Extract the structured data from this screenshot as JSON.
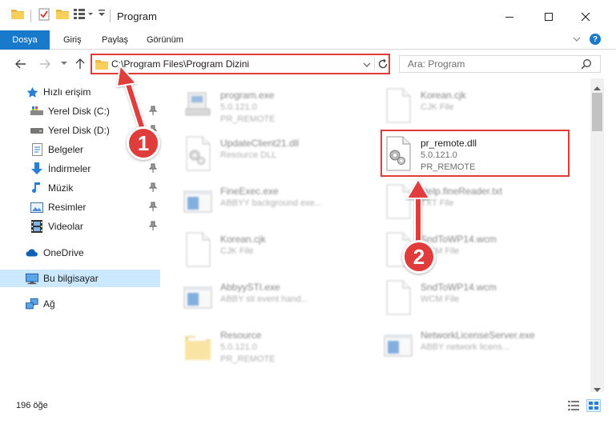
{
  "window": {
    "title": "Program"
  },
  "ribbon": {
    "tabs": [
      "Dosya",
      "Giriş",
      "Paylaş",
      "Görünüm"
    ]
  },
  "address": {
    "path": "C:\\Program Files\\Program Dizini"
  },
  "search": {
    "placeholder": "Ara: Program"
  },
  "sidebar": {
    "quick_access": "Hızlı erişim",
    "items": [
      "Yerel Disk (C:)",
      "Yerel Disk (D:)",
      "Belgeler",
      "İndirmeler",
      "Müzik",
      "Resimler",
      "Videolar"
    ],
    "onedrive": "OneDrive",
    "this_pc": "Bu bilgisayar",
    "network": "Ağ"
  },
  "files": [
    {
      "name": "program.exe",
      "line1": "5.0.121.0",
      "line2": "PR_REMOTE",
      "icon": "exe-icon"
    },
    {
      "name": "Korean.cjk",
      "line1": "CJK File",
      "line2": "",
      "icon": "blank-file-icon"
    },
    {
      "name": "UpdateClient21.dll",
      "line1": "Resource DLL",
      "line2": "",
      "icon": "dll-icon"
    },
    {
      "name": "pr_remote.dll",
      "line1": "5.0.121.0",
      "line2": "PR_REMOTE",
      "icon": "dll-icon"
    },
    {
      "name": "FineExec.exe",
      "line1": "ABBYY background exe...",
      "line2": "",
      "icon": "window-icon"
    },
    {
      "name": "Help.fineReader.txt",
      "line1": "TXT File",
      "line2": "",
      "icon": "blank-file-icon"
    },
    {
      "name": "Korean.cjk",
      "line1": "CJK File",
      "line2": "",
      "icon": "blank-file-icon"
    },
    {
      "name": "SndToWP14.wcm",
      "line1": "WCM File",
      "line2": "",
      "icon": "blank-file-icon"
    },
    {
      "name": "AbbyySTI.exe",
      "line1": "ABBY sti event hand...",
      "line2": "",
      "icon": "window-icon"
    },
    {
      "name": "SndToWP14.wcm",
      "line1": "WCM File",
      "line2": "",
      "icon": "blank-file-icon"
    },
    {
      "name": "Resource",
      "line1": "5.0.121.0",
      "line2": "PR_REMOTE",
      "icon": "folder-icon"
    },
    {
      "name": "NetworkLicenseServer.exe",
      "line1": "ABBY network licens...",
      "line2": "",
      "icon": "window-icon"
    }
  ],
  "status": {
    "item_count": "196 öğe"
  },
  "annotations": {
    "step1": "1",
    "step2": "2"
  },
  "colors": {
    "accent": "#1979ca",
    "highlight": "#e03c3c",
    "selection": "#cce8ff"
  }
}
